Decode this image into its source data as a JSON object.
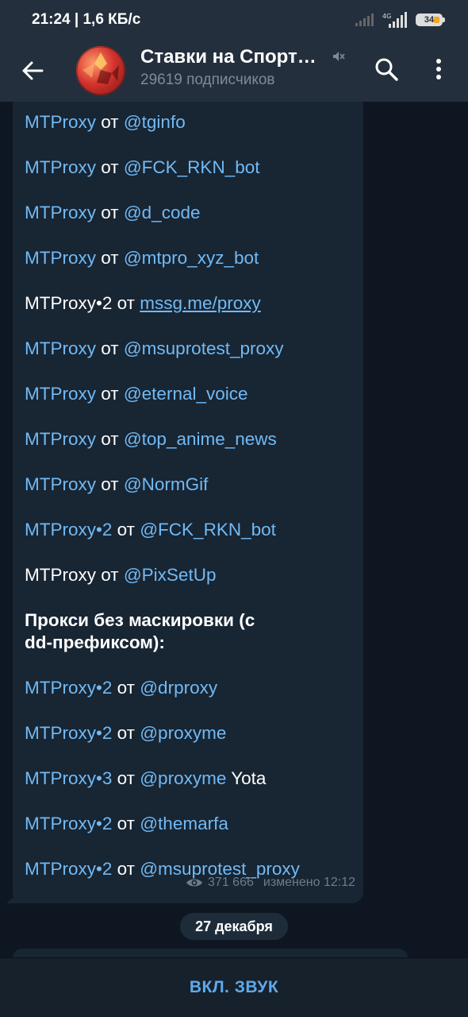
{
  "status": {
    "time": "21:24 | 1,6 КБ/с",
    "network": "4G",
    "battery": "34"
  },
  "header": {
    "title": "Ставки на Спорт…",
    "subtitle": "29619 подписчиков"
  },
  "message": {
    "lines": [
      {
        "a": "MTProxy",
        "b": " от ",
        "c": "@tginfo"
      },
      {
        "a": "MTProxy",
        "b": " от ",
        "c": "@FCK_RKN_bot"
      },
      {
        "a": "MTProxy",
        "b": " от ",
        "c": "@d_code"
      },
      {
        "a": "MTProxy",
        "b": " от ",
        "c": "@mtpro_xyz_bot"
      },
      {
        "a": "MTProxy•2",
        "b": " от ",
        "c": "mssg.me/proxy"
      },
      {
        "a": "MTProxy",
        "b": " от ",
        "c": "@msuprotest_proxy"
      },
      {
        "a": "MTProxy",
        "b": " от ",
        "c": "@eternal_voice"
      },
      {
        "a": "MTProxy",
        "b": " от ",
        "c": "@top_anime_news"
      },
      {
        "a": "MTProxy",
        "b": " от ",
        "c": "@NormGif"
      },
      {
        "a": "MTProxy•2",
        "b": " от ",
        "c": "@FCK_RKN_bot"
      },
      {
        "a": "MTProxy",
        "b": " от ",
        "c": "@PixSetUp"
      },
      {
        "heading": "Прокси без маскировки (с dd-префиксом):"
      },
      {
        "a": "MTProxy•2",
        "b": " от ",
        "c": "@drproxy"
      },
      {
        "a": "MTProxy•2",
        "b": " от ",
        "c": "@proxyme"
      },
      {
        "a": "MTProxy•3",
        "b": " от ",
        "c": "@proxyme",
        "d": " Yota"
      },
      {
        "a": "MTProxy•2",
        "b": " от ",
        "c": "@themarfa"
      },
      {
        "a": "MTProxy•2",
        "b": " от ",
        "c": "@msuprotest_proxy"
      }
    ],
    "views": "371 666",
    "edited": "изменено 12:12"
  },
  "date_separator": "27 декабря",
  "bottom": {
    "unmute_label": "ВКЛ. ЗВУК"
  },
  "colors": {
    "link": "#71baf5",
    "bubble": "#182533",
    "background": "#0e1621",
    "header": "#242f3d",
    "accent": "#5eaaed"
  }
}
